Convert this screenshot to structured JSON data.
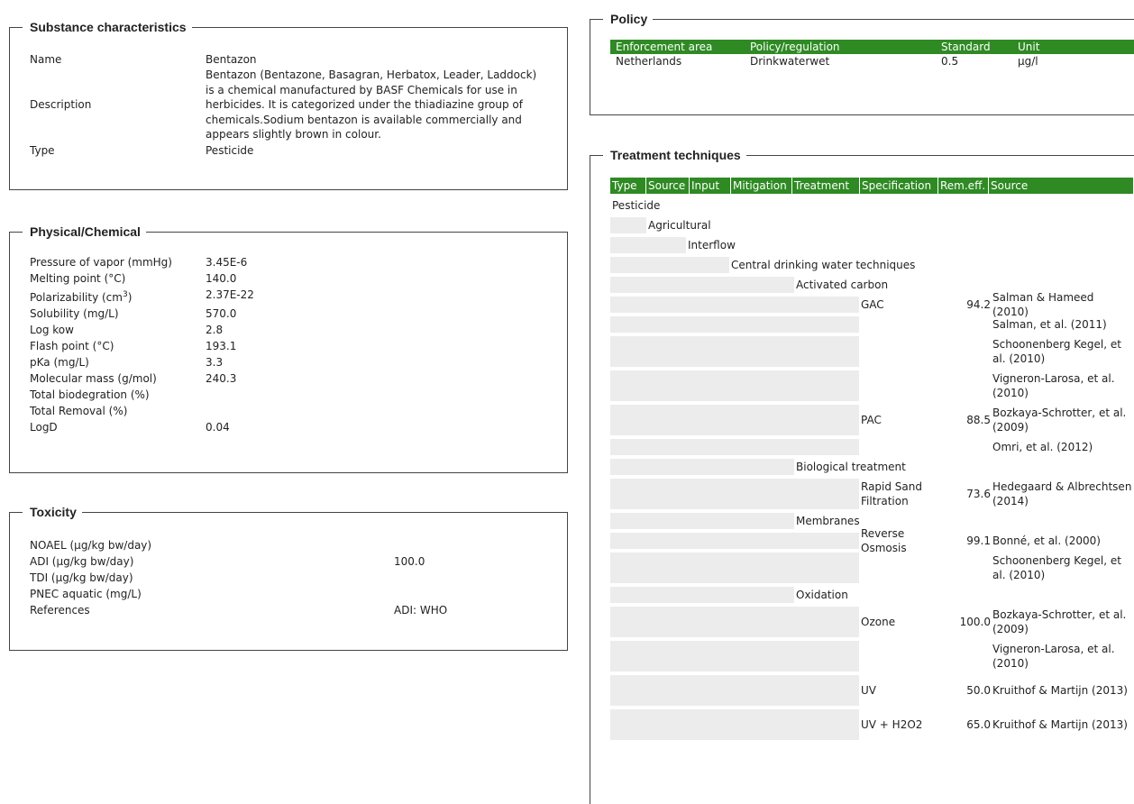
{
  "substance": {
    "title": "Substance characteristics",
    "rows": [
      {
        "label": "Name",
        "value": "Bentazon"
      },
      {
        "label": "Description",
        "value": "Bentazon (Bentazone, Basagran, Herbatox, Leader, Laddock) is a chemical manufactured by BASF Chemicals for use in herbicides. It is categorized under the thiadiazine group of chemicals.Sodium bentazon is available commercially and appears slightly brown in colour."
      },
      {
        "label": "Type",
        "value": "Pesticide"
      }
    ]
  },
  "physical": {
    "title": "Physical/Chemical",
    "rows": [
      {
        "label": "Pressure of vapor (mmHg)",
        "value": "3.45E-6"
      },
      {
        "label": "Melting point (°C)",
        "value": "140.0"
      },
      {
        "label": "Polarizability (cm",
        "sup": "3",
        "label_end": ")",
        "value": "2.37E-22"
      },
      {
        "label": "Solubility (mg/L)",
        "value": "570.0"
      },
      {
        "label": "Log kow",
        "value": "2.8"
      },
      {
        "label": "Flash point (°C)",
        "value": "193.1"
      },
      {
        "label": "pKa (mg/L)",
        "value": "3.3"
      },
      {
        "label": "Molecular mass (g/mol)",
        "value": "240.3"
      },
      {
        "label": "Total biodegration (%)",
        "value": ""
      },
      {
        "label": "Total Removal (%)",
        "value": ""
      },
      {
        "label": "LogD",
        "value": "0.04"
      }
    ]
  },
  "toxicity": {
    "title": "Toxicity",
    "rows": [
      {
        "label": "NOAEL (μg/kg bw/day)",
        "value": ""
      },
      {
        "label": "ADI (μg/kg bw/day)",
        "value": "100.0"
      },
      {
        "label": "TDI (μg/kg bw/day)",
        "value": ""
      },
      {
        "label": "PNEC aquatic (mg/L)",
        "value": ""
      },
      {
        "label": "References",
        "value": "ADI: WHO"
      }
    ]
  },
  "policy": {
    "title": "Policy",
    "headers": [
      "Enforcement area",
      "Policy/regulation",
      "Standard",
      "Unit"
    ],
    "rows": [
      [
        "Netherlands",
        "Drinkwaterwet",
        "0.5",
        "μg/l"
      ]
    ]
  },
  "treatment": {
    "title": "Treatment techniques",
    "headers": [
      "Type",
      "Source",
      "Input",
      "Mitigation",
      "Treatment",
      "Specification",
      "Rem.eff.",
      "Source"
    ],
    "hierarchy": {
      "type": "Pesticide",
      "source": "Agricultural",
      "input": "Interflow",
      "mitigation": "Central drinking water techniques"
    },
    "rows": [
      {
        "treatment": "Activated carbon"
      },
      {
        "tech": "GAC",
        "eff": "94.2",
        "src": "Salman & Hameed (2010)"
      },
      {
        "src": "Salman, et al. (2011)"
      },
      {
        "src": "Schoonenberg Kegel, et al. (2010)"
      },
      {
        "src": "Vigneron-Larosa, et al. (2010)"
      },
      {
        "tech": "PAC",
        "eff": "88.5",
        "src": "Bozkaya-Schrotter, et al. (2009)"
      },
      {
        "src": "Omri, et al. (2012)"
      },
      {
        "treatment": "Biological treatment"
      },
      {
        "tech": "Rapid Sand Filtration",
        "eff": "73.6",
        "src": "Hedegaard & Albrechtsen (2014)"
      },
      {
        "treatment": "Membranes"
      },
      {
        "tech": "Reverse Osmosis",
        "eff": "99.1",
        "src": "Bonné, et al. (2000)"
      },
      {
        "src": "Schoonenberg Kegel, et al. (2010)"
      },
      {
        "treatment": "Oxidation"
      },
      {
        "tech": "Ozone",
        "eff": "100.0",
        "src": "Bozkaya-Schrotter, et al. (2009)"
      },
      {
        "src": "Vigneron-Larosa, et al. (2010)"
      },
      {
        "tech": "UV",
        "eff": "50.0",
        "src": "Kruithof & Martijn (2013)"
      },
      {
        "tech": "UV + H2O2",
        "eff": "65.0",
        "src": "Kruithof & Martijn (2013)"
      }
    ]
  },
  "colors": {
    "header_green": "#2f8a24",
    "pad_gray": "#ececec"
  }
}
